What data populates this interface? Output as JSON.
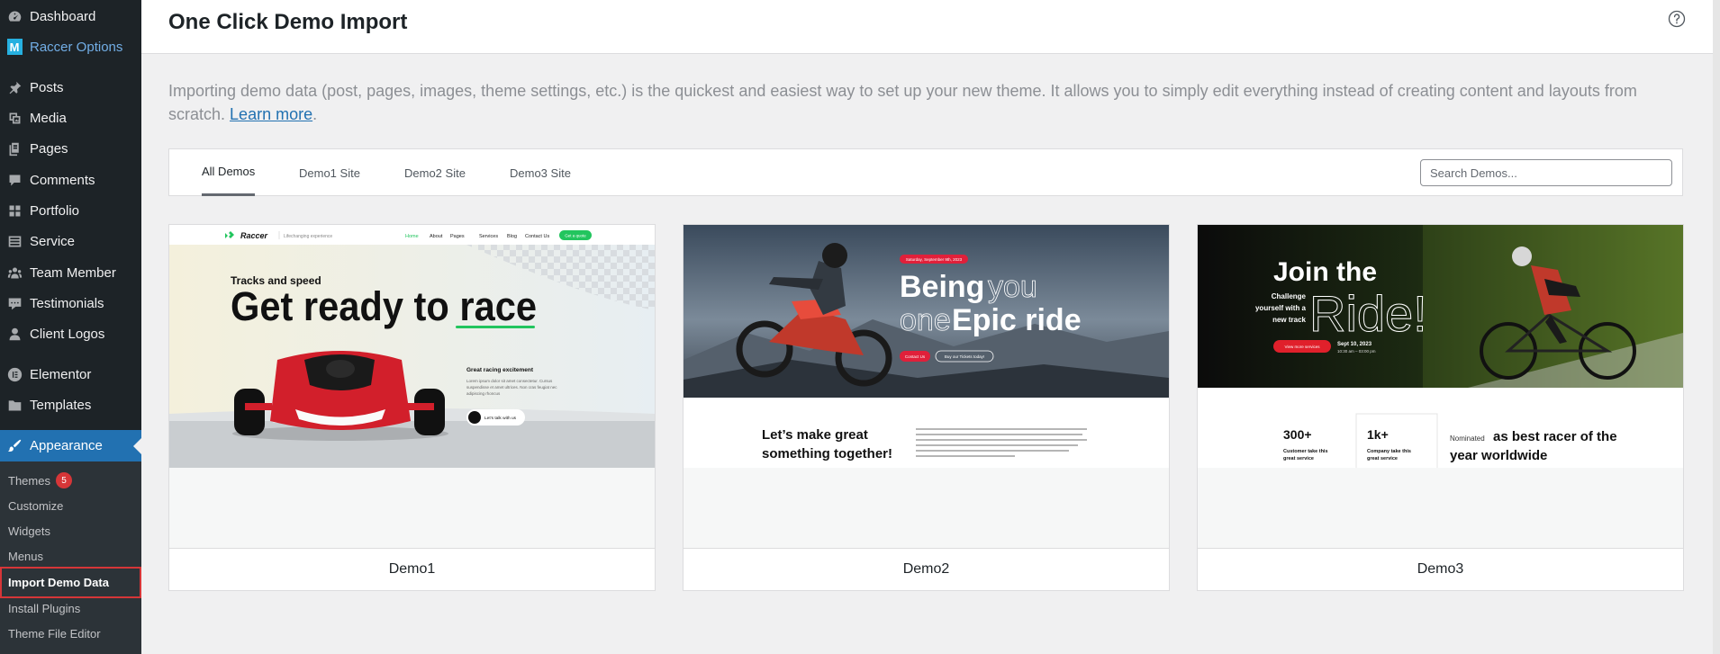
{
  "sidebar": {
    "items": [
      {
        "label": "Dashboard",
        "icon": "dashboard-icon"
      },
      {
        "label": "Raccer Options",
        "icon": "raccer-logo-icon",
        "logo_letter": "M"
      },
      {
        "label": "Posts",
        "icon": "pin-icon"
      },
      {
        "label": "Media",
        "icon": "media-icon"
      },
      {
        "label": "Pages",
        "icon": "pages-icon"
      },
      {
        "label": "Comments",
        "icon": "comment-icon"
      },
      {
        "label": "Portfolio",
        "icon": "grid-icon"
      },
      {
        "label": "Service",
        "icon": "list-icon"
      },
      {
        "label": "Team Member",
        "icon": "groups-icon"
      },
      {
        "label": "Testimonials",
        "icon": "testimonial-icon"
      },
      {
        "label": "Client Logos",
        "icon": "user-icon"
      },
      {
        "label": "Elementor",
        "icon": "elementor-icon"
      },
      {
        "label": "Templates",
        "icon": "folder-icon"
      },
      {
        "label": "Appearance",
        "icon": "brush-icon"
      }
    ],
    "submenu": [
      {
        "label": "Themes",
        "badge": "5"
      },
      {
        "label": "Customize"
      },
      {
        "label": "Widgets"
      },
      {
        "label": "Menus"
      },
      {
        "label": "Import Demo Data"
      },
      {
        "label": "Install Plugins"
      },
      {
        "label": "Theme File Editor"
      }
    ]
  },
  "header": {
    "title": "One Click Demo Import",
    "help_icon": "help-circle-icon"
  },
  "intro": {
    "text": "Importing demo data (post, pages, images, theme settings, etc.) is the quickest and easiest way to set up your new theme. It allows you to simply edit everything instead of creating content and layouts from scratch.",
    "link": "Learn more",
    "link_suffix": "."
  },
  "tabs": [
    "All Demos",
    "Demo1 Site",
    "Demo2 Site",
    "Demo3 Site"
  ],
  "search": {
    "placeholder": "Search Demos..."
  },
  "demos": [
    {
      "name": "Demo1",
      "preview": {
        "brand": "Raccer",
        "tagline": "Lifechanging experience",
        "nav": [
          "Home",
          "About",
          "Pages",
          "Services",
          "Blog",
          "Contact Us"
        ],
        "nav_cta": "Get a quote",
        "kicker": "Tracks and speed",
        "headline": "Get ready to race",
        "side_title": "Great racing excitement",
        "side_lines": [
          "Lorem ipsum dolor sit amet consectetur. Cursus",
          "suspendisse et amet ultrices. Non cras feugiat nec",
          "adipiscing rhoncus"
        ],
        "cta": "Let's talk with us"
      }
    },
    {
      "name": "Demo2",
      "preview": {
        "date_pill": "Saturday, September 9th, 2023",
        "line1a": "Being",
        "line1b": "you",
        "line2a": "one",
        "line2b": "Epic ride",
        "btn1": "Contact Us",
        "btn2": "Buy our Tickets today!",
        "lower_title_1": "Let’s make great",
        "lower_title_2": "something together!"
      }
    },
    {
      "name": "Demo3",
      "preview": {
        "title": "Join the",
        "ride": "Ride!",
        "sub": [
          "Challenge",
          "yourself with a",
          "new track"
        ],
        "btn": "View more services",
        "date": "Sept 10, 2023",
        "time": "10:30 am – 03:00 pm",
        "stat1": "300+",
        "stat1_lbl": [
          "Customer take this",
          "great service"
        ],
        "stat2": "1k+",
        "stat2_lbl": [
          "Company take this",
          "great service"
        ],
        "nominated": "Nominated",
        "award_1": "as best racer of the",
        "award_2": "year worldwide"
      }
    }
  ],
  "colors": {
    "sidebar_bg": "#1d2327",
    "active": "#2271b1",
    "badge": "#d63638",
    "demo1_green": "#22c55e",
    "demo2_red": "#e0203a",
    "demo3_red": "#e0202b"
  }
}
